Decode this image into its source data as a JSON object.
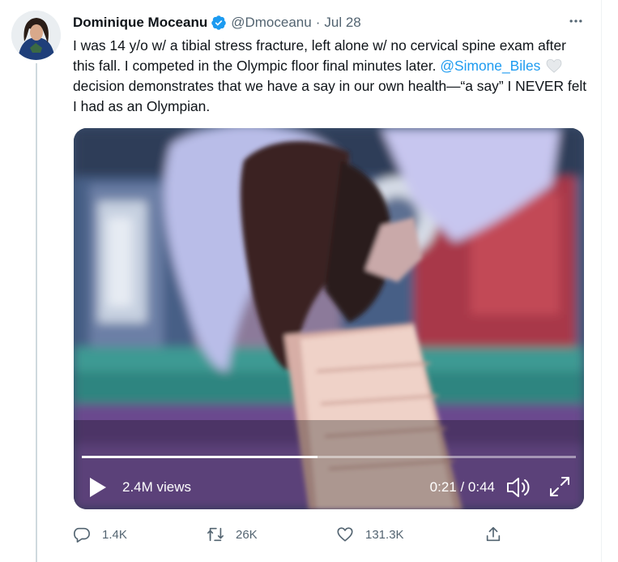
{
  "tweet": {
    "author_name": "Dominique Moceanu",
    "handle": "@Dmoceanu",
    "separator": "·",
    "date": "Jul 28",
    "more_icon": "more-horizontal-icon",
    "text_part1": "I was 14 y/o w/ a tibial stress fracture, left alone w/ no cervical spine exam after this fall. I competed in the Olympic floor final minutes later.",
    "mention": "@Simone_Biles",
    "text_part2": "decision demonstrates that we have a say in our own health—“a say” I NEVER felt I had as an Olympian."
  },
  "video": {
    "views": "2.4M views",
    "time": "0:21 / 0:44",
    "progress_fraction": 0.477
  },
  "actions": {
    "replies": "1.4K",
    "retweets": "26K",
    "likes": "131.3K"
  },
  "colors": {
    "accent": "#1d9bf0",
    "secondary_text": "#536471",
    "primary_text": "#0f1419"
  }
}
